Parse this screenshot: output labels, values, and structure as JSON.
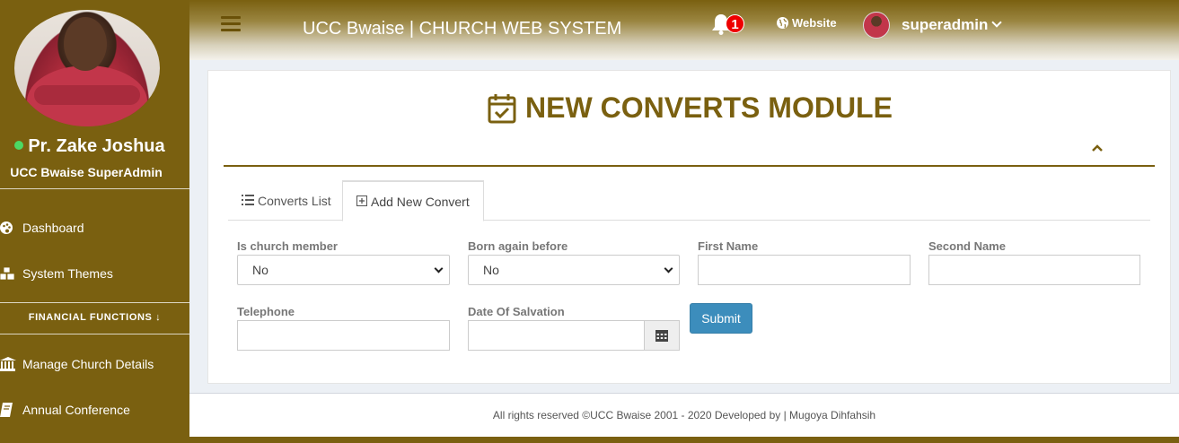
{
  "sidebar": {
    "user_name": "Pr. Zake Joshua",
    "user_role": "UCC Bwaise SuperAdmin",
    "items": [
      {
        "label": "Dashboard",
        "icon": "palette-icon"
      },
      {
        "label": "System Themes",
        "icon": "cubes-icon"
      }
    ],
    "section_label": "FINANCIAL FUNCTIONS ↓",
    "items2": [
      {
        "label": "Manage Church Details",
        "icon": "institution-icon"
      },
      {
        "label": "Annual Conference",
        "icon": "book-icon"
      }
    ]
  },
  "header": {
    "title": "UCC Bwaise | CHURCH WEB SYSTEM",
    "notification_count": "1",
    "website_label": "Website",
    "username": "superadmin"
  },
  "module": {
    "title": "NEW CONVERTS MODULE"
  },
  "tabs": [
    {
      "label": "Converts List",
      "icon": "list-icon",
      "active": false
    },
    {
      "label": "Add New Convert",
      "icon": "plus-square-icon",
      "active": true
    }
  ],
  "form": {
    "is_member": {
      "label": "Is church member",
      "value": "No"
    },
    "born_again": {
      "label": "Born again before",
      "value": "No"
    },
    "first_name": {
      "label": "First Name",
      "value": ""
    },
    "second_name": {
      "label": "Second Name",
      "value": ""
    },
    "telephone": {
      "label": "Telephone",
      "value": ""
    },
    "date_salvation": {
      "label": "Date Of Salvation",
      "value": ""
    },
    "submit_label": "Submit"
  },
  "footer": {
    "text": "All rights reserved ©UCC Bwaise 2001 - 2020 Developed by | Mugoya Dihfahsih"
  },
  "colors": {
    "brand": "#7a6010",
    "primary_button": "#3c8dbc",
    "status_online": "#4cd964",
    "badge": "#e00000"
  }
}
